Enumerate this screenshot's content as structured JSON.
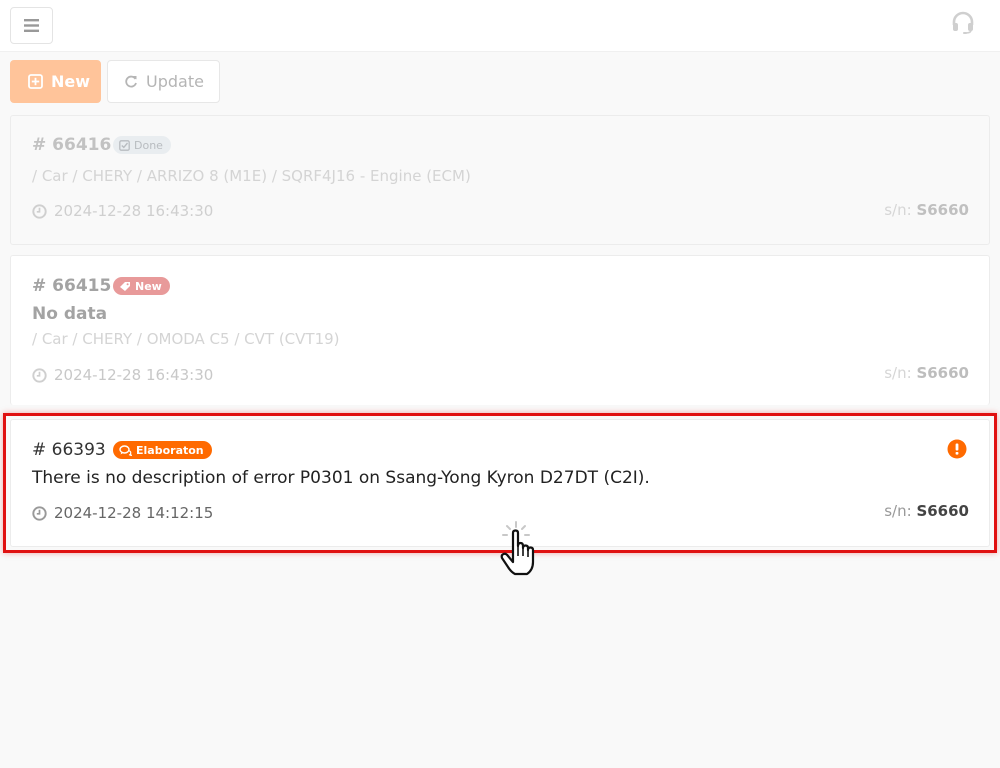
{
  "header": {
    "menu_icon": "hamburger-menu-icon",
    "support_icon": "headset-icon"
  },
  "toolbar": {
    "new_label": "New",
    "new_icon": "plus-square-icon",
    "update_label": "Update",
    "update_icon": "refresh-icon"
  },
  "colors": {
    "accent_orange": "#ff6a00",
    "new_button": "#ffc49a",
    "badge_new": "#e89a9a",
    "badge_done": "#e9edf0",
    "highlight_red": "#e01010"
  },
  "tickets": [
    {
      "id": "# 66416",
      "status": "Done",
      "status_icon": "check-square-icon",
      "title": "",
      "path": "/ Car / CHERY / ARRIZO 8 (M1E) / SQRF4J16 - Engine (ECM)",
      "time": "2024-12-28 16:43:30",
      "sn_label": "s/n:",
      "sn_value": "S6660"
    },
    {
      "id": "# 66415",
      "status": "New",
      "status_icon": "tag-icon",
      "title": "No data",
      "path": "/ Car / CHERY / OMODA C5 / CVT (CVT19)",
      "time": "2024-12-28 16:43:30",
      "sn_label": "s/n:",
      "sn_value": "S6660"
    },
    {
      "id": "# 66393",
      "status": "Elaboraton",
      "status_icon": "comments-icon",
      "title": "There is no description of error P0301 on Ssang-Yong Kyron D27DT (C2I).",
      "path": "",
      "time": "2024-12-28 14:12:15",
      "sn_label": "s/n:",
      "sn_value": "S6660",
      "alert_icon": "exclamation-circle-icon"
    }
  ]
}
